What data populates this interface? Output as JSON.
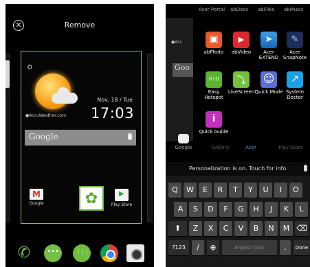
{
  "left_screen": {
    "close_symbol": "✕",
    "remove_label": "Remove",
    "gear_symbol": "⚙",
    "weather_brand": "●AccuWeather.com",
    "date": "Nov. 18 / Tue",
    "time": "17:03",
    "search_placeholder": "Google",
    "home_apps": [
      {
        "label": "Google"
      },
      {
        "label": ""
      },
      {
        "label": "Play Store"
      }
    ],
    "dock_phone_symbol": "✆"
  },
  "right_screen": {
    "top_labels": [
      "Acer Portal",
      "abDocs",
      "abFiles",
      "abMusic"
    ],
    "bg_brand": "●Acc",
    "bg_search": "Goo",
    "folder_apps": [
      {
        "label": "abPhoto",
        "icon": "photo-icon"
      },
      {
        "label": "abVideo",
        "icon": "video-icon"
      },
      {
        "label": "Acer EXTEND",
        "icon": "extend-icon"
      },
      {
        "label": "Acer SnapNote",
        "icon": "snapnote-icon"
      },
      {
        "label": "Easy Hotspot",
        "icon": "hotspot-icon"
      },
      {
        "label": "LiveScreen",
        "icon": "livescreen-icon"
      },
      {
        "label": "Quick Mode",
        "icon": "quick-mode-icon"
      },
      {
        "label": "System Doctor",
        "icon": "system-doctor-icon"
      },
      {
        "label": "Quick Guide",
        "icon": "quick-guide-icon"
      }
    ],
    "dock_labels": [
      "Google",
      "Gallery",
      "Acer",
      "Play Store"
    ],
    "notice_text": "Personalization is on. Touch for info.",
    "keyboard": {
      "row1": [
        "Q",
        "W",
        "E",
        "R",
        "T",
        "Y",
        "U",
        "I",
        "O"
      ],
      "row2": [
        "A",
        "S",
        "D",
        "F",
        "G",
        "H",
        "J",
        "K",
        "L"
      ],
      "row3_shift": "⬆",
      "row3": [
        "Z",
        "X",
        "C",
        "V",
        "B",
        "N",
        "M"
      ],
      "row3_delete": "⌫",
      "row4_num": "?123",
      "row4_slash": "/",
      "row4_globe": "⊕",
      "row4_space": "English (US)",
      "row4_dot": ".",
      "row4_done": "Done"
    }
  }
}
